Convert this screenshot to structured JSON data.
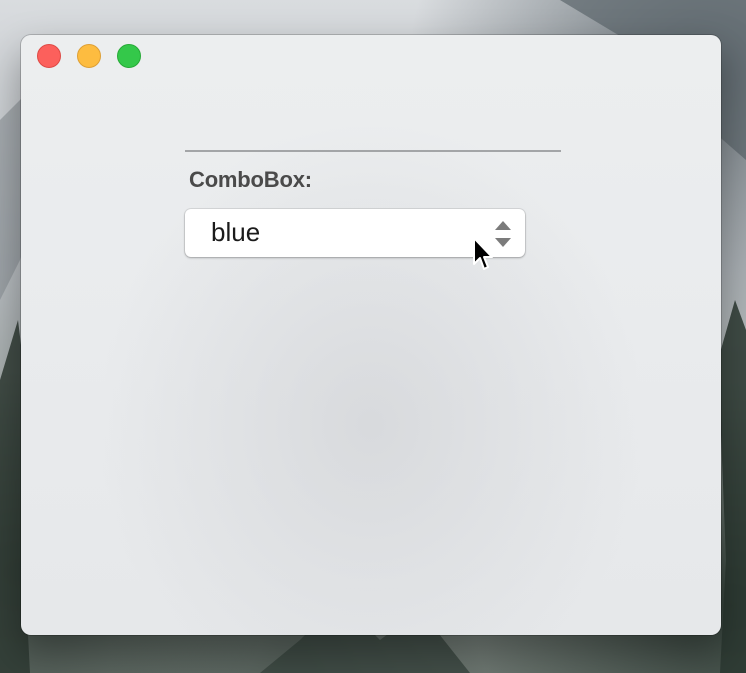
{
  "window": {
    "controls": [
      "close",
      "minimize",
      "zoom"
    ],
    "colors": {
      "close": "#fc605c",
      "minimize": "#fdbc40",
      "zoom": "#34c84a"
    }
  },
  "form": {
    "label": "ComboBox:",
    "combobox": {
      "value": "blue",
      "icon": "stepper-arrows-icon"
    }
  },
  "pointer": {
    "icon": "mouse-pointer-icon"
  }
}
